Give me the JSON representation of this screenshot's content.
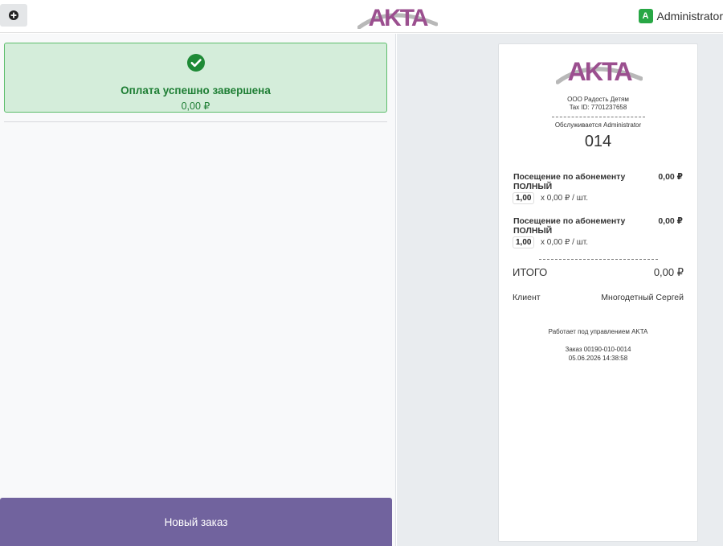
{
  "header": {
    "add_icon": "plus-circle-icon",
    "logo_text": "AKTA",
    "user_initial": "A",
    "user_name": "Administrator"
  },
  "payment": {
    "status_icon": "check-circle-icon",
    "title": "Оплата успешно завершена",
    "amount": "0,00 ₽"
  },
  "actions": {
    "new_order": "Новый заказ"
  },
  "receipt": {
    "logo_text": "AKTA",
    "company": "ООО Радость Детям",
    "tax_id": "Tax ID: 7701237658",
    "served_by": "Обслуживается Administrator",
    "order_number": "014",
    "items": [
      {
        "name": "Посещение по абонементу ПОЛНЫЙ",
        "price": "0,00 ₽",
        "qty": "1,00",
        "unit_price": "x 0,00 ₽ / шт."
      },
      {
        "name": "Посещение по абонементу ПОЛНЫЙ",
        "price": "0,00 ₽",
        "qty": "1,00",
        "unit_price": "x 0,00 ₽ / шт."
      }
    ],
    "total_label": "ИТОГО",
    "total_value": "0,00 ₽",
    "client_label": "Клиент",
    "client_value": "Многодетный Сергей",
    "powered_by": "Работает под управлением AKTA",
    "order_ref": "Заказ 00190-010-0014",
    "datetime": "05.06.2026 14:38:58"
  },
  "colors": {
    "brand_purple": "#9b4f8f",
    "brand_grey": "#b8b8b8",
    "success_bg": "#d4edda",
    "success_text": "#1e7e34",
    "button_purple": "#71639e",
    "avatar_green": "#28a745"
  }
}
